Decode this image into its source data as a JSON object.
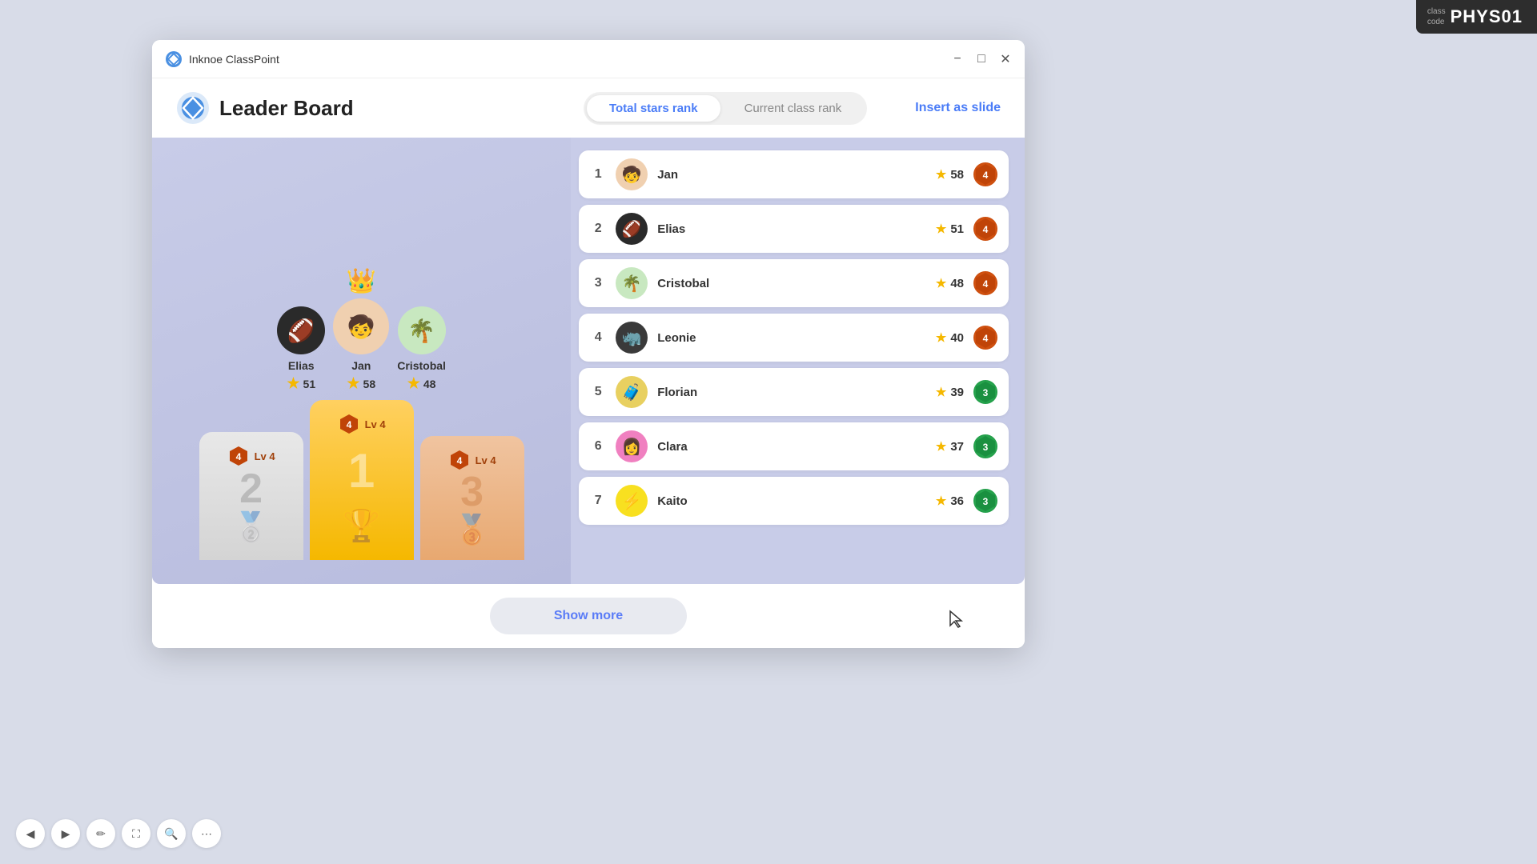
{
  "classCode": {
    "label": "class\ncode",
    "value": "PHYS01"
  },
  "titlebar": {
    "appName": "Inknoe ClassPoint",
    "minimizeLabel": "−",
    "maximizeLabel": "□",
    "closeLabel": "✕"
  },
  "header": {
    "title": "Leader Board",
    "tabs": [
      {
        "label": "Total stars rank",
        "active": true
      },
      {
        "label": "Current class rank",
        "active": false
      }
    ],
    "insertBtn": "Insert as slide"
  },
  "podium": {
    "crown": "👑",
    "contestants": [
      {
        "rank": 2,
        "name": "Elias",
        "stars": 51,
        "avatar": "🏈",
        "avatarClass": "av-elias"
      },
      {
        "rank": 1,
        "name": "Jan",
        "stars": 58,
        "avatar": "🧒",
        "avatarClass": "av-jan"
      },
      {
        "rank": 3,
        "name": "Cristobal",
        "stars": 48,
        "avatar": "🌴",
        "avatarClass": "av-cristobal"
      }
    ],
    "blocks": [
      {
        "rank": 2,
        "level": "Lv 4",
        "badge": "4",
        "trophy": "🥈",
        "class": "rank2"
      },
      {
        "rank": 1,
        "level": "Lv 4",
        "badge": "4",
        "trophy": "🏆",
        "class": "rank1"
      },
      {
        "rank": 3,
        "level": "Lv 4",
        "badge": "4",
        "trophy": "🥉",
        "class": "rank3"
      }
    ]
  },
  "leaderboard": {
    "rows": [
      {
        "rank": 1,
        "name": "Jan",
        "stars": 58,
        "level": 4,
        "levelClass": "orange",
        "avatar": "🧒",
        "avatarClass": "av-jan"
      },
      {
        "rank": 2,
        "name": "Elias",
        "stars": 51,
        "level": 4,
        "levelClass": "orange",
        "avatar": "🏈",
        "avatarClass": "av-elias"
      },
      {
        "rank": 3,
        "name": "Cristobal",
        "stars": 48,
        "level": 4,
        "levelClass": "orange",
        "avatar": "🌴",
        "avatarClass": "av-cristobal"
      },
      {
        "rank": 4,
        "name": "Leonie",
        "stars": 40,
        "level": 4,
        "levelClass": "orange",
        "avatar": "🦏",
        "avatarClass": "av-leonie"
      },
      {
        "rank": 5,
        "name": "Florian",
        "stars": 39,
        "level": 3,
        "levelClass": "green",
        "avatar": "🧳",
        "avatarClass": "av-florian"
      },
      {
        "rank": 6,
        "name": "Clara",
        "stars": 37,
        "level": 3,
        "levelClass": "green",
        "avatar": "👩",
        "avatarClass": "av-clara"
      },
      {
        "rank": 7,
        "name": "Kaito",
        "stars": 36,
        "level": 3,
        "levelClass": "green",
        "avatar": "⚡",
        "avatarClass": "av-kaito"
      }
    ]
  },
  "footer": {
    "showMoreLabel": "Show more"
  },
  "taskbar": {
    "buttons": [
      "◀",
      "▶",
      "✏",
      "⛶",
      "🔍",
      "⋯"
    ]
  }
}
